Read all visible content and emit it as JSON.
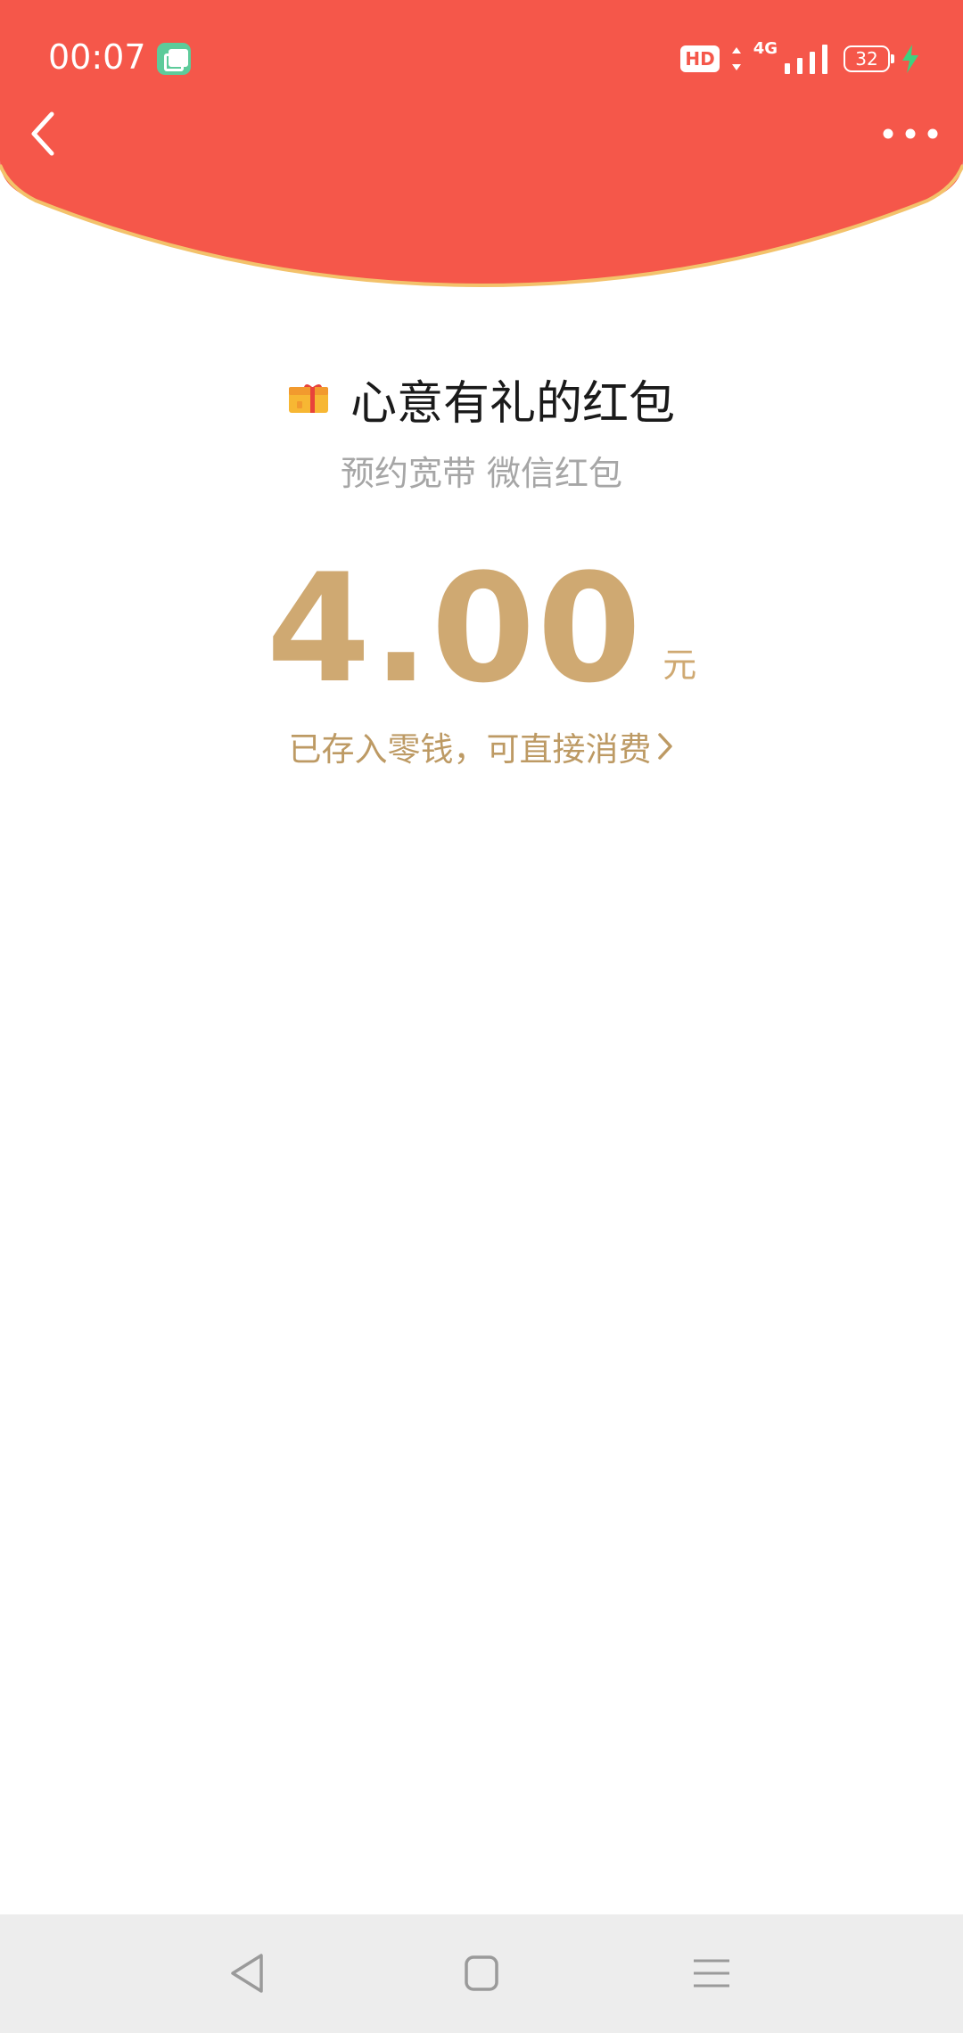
{
  "status_bar": {
    "time": "00:07",
    "hd": "HD",
    "network": "4G",
    "battery": "32"
  },
  "header": {
    "back_icon": "chevron-left-icon",
    "more_icon": "more-dots-icon",
    "colors": {
      "background": "#f5574a",
      "curve_border": "#f3c26b"
    }
  },
  "red_packet": {
    "title": "心意有礼的红包",
    "subtitle": "预约宽带 微信红包",
    "amount": "4.00",
    "unit": "元",
    "note": "已存入零钱，可直接消费",
    "gift_icon": "gift-box-icon",
    "colors": {
      "amount": "#cfa972",
      "note": "#bd9a64"
    }
  },
  "system_nav": {
    "back": "triangle-back-icon",
    "home": "square-home-icon",
    "menu": "hamburger-menu-icon"
  }
}
